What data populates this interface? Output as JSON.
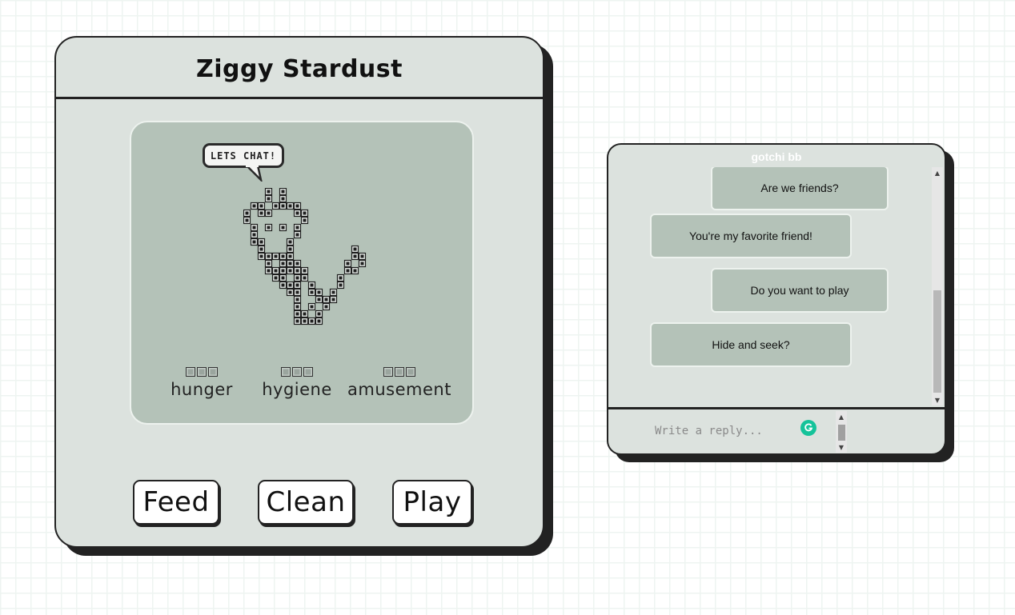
{
  "pet": {
    "name": "Ziggy Stardust",
    "speech_bubble": "LETS CHAT!",
    "stats": [
      {
        "label": "hunger",
        "level": 3,
        "max": 3
      },
      {
        "label": "hygiene",
        "level": 3,
        "max": 3
      },
      {
        "label": "amusement",
        "level": 3,
        "max": 3
      }
    ],
    "actions": {
      "feed_label": "Feed",
      "clean_label": "Clean",
      "play_label": "Play"
    }
  },
  "chat": {
    "title": "gotchi bb",
    "messages": [
      {
        "text": "Are we friends?",
        "side": "right"
      },
      {
        "text": "You're my favorite friend!",
        "side": "left"
      },
      {
        "text": "Do you want to play",
        "side": "right"
      },
      {
        "text": "Hide and seek?",
        "side": "left"
      }
    ],
    "reply_placeholder": "Write a reply..."
  },
  "colors": {
    "panel_bg": "#dce2de",
    "screen_bg": "#b4c2b8",
    "outline": "#222222",
    "grammarly": "#15c39a"
  },
  "icons": {
    "pet_sprite": "pixel-cat-icon",
    "speech_bubble": "speech-bubble-icon",
    "stat_pip": "pixel-square-icon",
    "assistant": "grammarly-icon"
  }
}
